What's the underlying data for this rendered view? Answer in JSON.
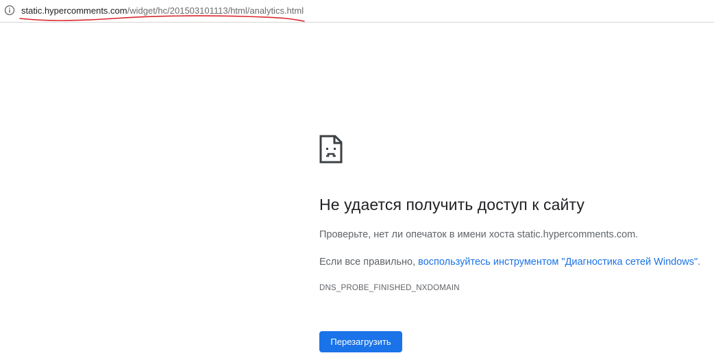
{
  "address_bar": {
    "url_host": "static.hypercomments.com",
    "url_path": "/widget/hc/201503101113/html/analytics.html",
    "info_icon": "info-circle-icon"
  },
  "error": {
    "icon": "sad-page-icon",
    "title": "Не удается получить доступ к сайту",
    "line1": "Проверьте, нет ли опечаток в имени хоста static.hypercomments.com.",
    "line2_prefix": "Если все правильно, ",
    "line2_link": "воспользуйтесь инструментом \"Диагностика сетей Windows\"",
    "line2_suffix": ".",
    "code": "DNS_PROBE_FINISHED_NXDOMAIN",
    "reload_label": "Перезагрузить"
  },
  "colors": {
    "accent": "#1a73e8",
    "annotation": "#d9262b",
    "title": "#202124",
    "body_text": "#5f6368"
  }
}
